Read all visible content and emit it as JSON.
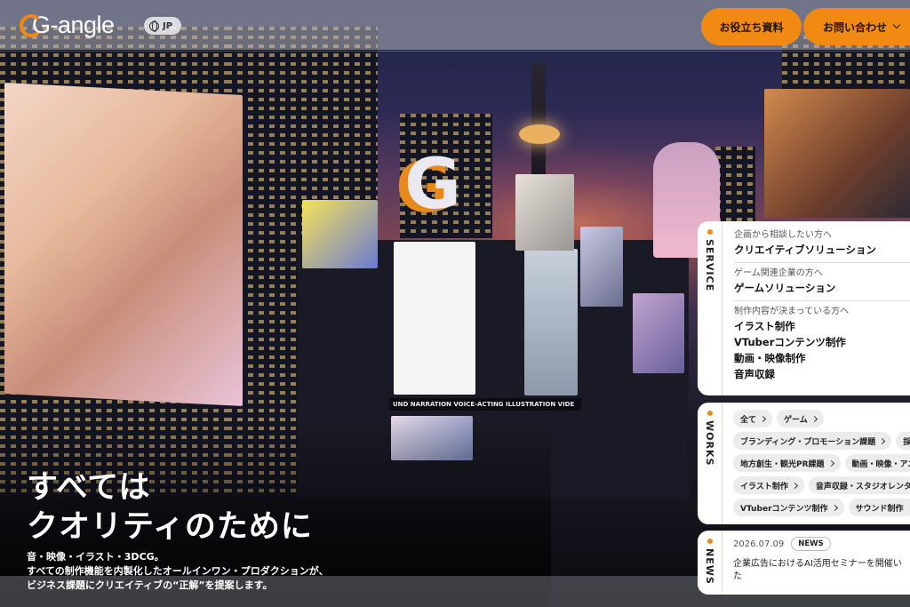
{
  "header": {
    "logo_text": "G-angle",
    "lang_label": "JP",
    "docs_button": "お役立ち資料",
    "contact_button": "お問い合わせ"
  },
  "hero": {
    "headline": [
      "すべては",
      "クオリティのために"
    ],
    "subcopy": [
      "音・映像・イラスト・3DCG。",
      "すべての制作機能を内製化したオールインワン・プロダクションが、",
      "ビジネス課題にクリエイティブの“正解”を提案します。"
    ],
    "signage_text": "UND  NARRATION  VOICE-ACTING  ILLUSTRATION  VIDE"
  },
  "service": {
    "tab_label": "SERVICE",
    "groups": [
      {
        "caption": "企画から相談したい方へ",
        "items": [
          "クリエイティブソリューション"
        ]
      },
      {
        "caption": "ゲーム関連企業の方へ",
        "items": [
          "ゲームソリューション"
        ]
      },
      {
        "caption": "制作内容が決まっている方へ",
        "items": [
          "イラスト制作",
          "VTuberコンテンツ制作",
          "動画・映像制作",
          "音声収録"
        ]
      }
    ]
  },
  "works": {
    "tab_label": "WORKS",
    "tag_rows": [
      [
        "全て",
        "ゲーム"
      ],
      [
        "ブランディング・プロモーション課題",
        "採用"
      ],
      [
        "地方創生・観光PR課題",
        "動画・映像・アニメ"
      ],
      [
        "イラスト制作",
        "音声収録・スタジオレンタル"
      ],
      [
        "VTuberコンテンツ制作",
        "サウンド制作"
      ]
    ]
  },
  "news": {
    "tab_label": "NEWS",
    "date": "2026.07.09",
    "badge": "NEWS",
    "title": "企業広告におけるAI活用セミナーを開催いた"
  },
  "colors": {
    "accent": "#f08a13",
    "card_bg": "#ffffff",
    "tag_bg": "#ececec"
  }
}
